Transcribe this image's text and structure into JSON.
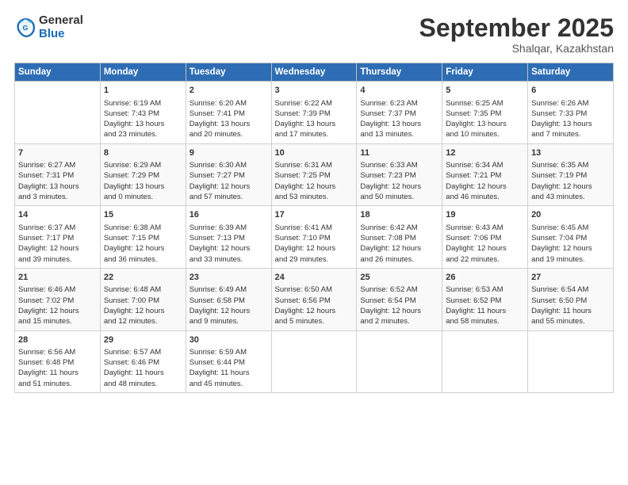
{
  "header": {
    "logo_general": "General",
    "logo_blue": "Blue",
    "month": "September 2025",
    "location": "Shalqar, Kazakhstan"
  },
  "days": [
    "Sunday",
    "Monday",
    "Tuesday",
    "Wednesday",
    "Thursday",
    "Friday",
    "Saturday"
  ],
  "weeks": [
    [
      {
        "date": "",
        "info": ""
      },
      {
        "date": "1",
        "info": "Sunrise: 6:19 AM\nSunset: 7:43 PM\nDaylight: 13 hours\nand 23 minutes."
      },
      {
        "date": "2",
        "info": "Sunrise: 6:20 AM\nSunset: 7:41 PM\nDaylight: 13 hours\nand 20 minutes."
      },
      {
        "date": "3",
        "info": "Sunrise: 6:22 AM\nSunset: 7:39 PM\nDaylight: 13 hours\nand 17 minutes."
      },
      {
        "date": "4",
        "info": "Sunrise: 6:23 AM\nSunset: 7:37 PM\nDaylight: 13 hours\nand 13 minutes."
      },
      {
        "date": "5",
        "info": "Sunrise: 6:25 AM\nSunset: 7:35 PM\nDaylight: 13 hours\nand 10 minutes."
      },
      {
        "date": "6",
        "info": "Sunrise: 6:26 AM\nSunset: 7:33 PM\nDaylight: 13 hours\nand 7 minutes."
      }
    ],
    [
      {
        "date": "7",
        "info": "Sunrise: 6:27 AM\nSunset: 7:31 PM\nDaylight: 13 hours\nand 3 minutes."
      },
      {
        "date": "8",
        "info": "Sunrise: 6:29 AM\nSunset: 7:29 PM\nDaylight: 13 hours\nand 0 minutes."
      },
      {
        "date": "9",
        "info": "Sunrise: 6:30 AM\nSunset: 7:27 PM\nDaylight: 12 hours\nand 57 minutes."
      },
      {
        "date": "10",
        "info": "Sunrise: 6:31 AM\nSunset: 7:25 PM\nDaylight: 12 hours\nand 53 minutes."
      },
      {
        "date": "11",
        "info": "Sunrise: 6:33 AM\nSunset: 7:23 PM\nDaylight: 12 hours\nand 50 minutes."
      },
      {
        "date": "12",
        "info": "Sunrise: 6:34 AM\nSunset: 7:21 PM\nDaylight: 12 hours\nand 46 minutes."
      },
      {
        "date": "13",
        "info": "Sunrise: 6:35 AM\nSunset: 7:19 PM\nDaylight: 12 hours\nand 43 minutes."
      }
    ],
    [
      {
        "date": "14",
        "info": "Sunrise: 6:37 AM\nSunset: 7:17 PM\nDaylight: 12 hours\nand 39 minutes."
      },
      {
        "date": "15",
        "info": "Sunrise: 6:38 AM\nSunset: 7:15 PM\nDaylight: 12 hours\nand 36 minutes."
      },
      {
        "date": "16",
        "info": "Sunrise: 6:39 AM\nSunset: 7:13 PM\nDaylight: 12 hours\nand 33 minutes."
      },
      {
        "date": "17",
        "info": "Sunrise: 6:41 AM\nSunset: 7:10 PM\nDaylight: 12 hours\nand 29 minutes."
      },
      {
        "date": "18",
        "info": "Sunrise: 6:42 AM\nSunset: 7:08 PM\nDaylight: 12 hours\nand 26 minutes."
      },
      {
        "date": "19",
        "info": "Sunrise: 6:43 AM\nSunset: 7:06 PM\nDaylight: 12 hours\nand 22 minutes."
      },
      {
        "date": "20",
        "info": "Sunrise: 6:45 AM\nSunset: 7:04 PM\nDaylight: 12 hours\nand 19 minutes."
      }
    ],
    [
      {
        "date": "21",
        "info": "Sunrise: 6:46 AM\nSunset: 7:02 PM\nDaylight: 12 hours\nand 15 minutes."
      },
      {
        "date": "22",
        "info": "Sunrise: 6:48 AM\nSunset: 7:00 PM\nDaylight: 12 hours\nand 12 minutes."
      },
      {
        "date": "23",
        "info": "Sunrise: 6:49 AM\nSunset: 6:58 PM\nDaylight: 12 hours\nand 9 minutes."
      },
      {
        "date": "24",
        "info": "Sunrise: 6:50 AM\nSunset: 6:56 PM\nDaylight: 12 hours\nand 5 minutes."
      },
      {
        "date": "25",
        "info": "Sunrise: 6:52 AM\nSunset: 6:54 PM\nDaylight: 12 hours\nand 2 minutes."
      },
      {
        "date": "26",
        "info": "Sunrise: 6:53 AM\nSunset: 6:52 PM\nDaylight: 11 hours\nand 58 minutes."
      },
      {
        "date": "27",
        "info": "Sunrise: 6:54 AM\nSunset: 6:50 PM\nDaylight: 11 hours\nand 55 minutes."
      }
    ],
    [
      {
        "date": "28",
        "info": "Sunrise: 6:56 AM\nSunset: 6:48 PM\nDaylight: 11 hours\nand 51 minutes."
      },
      {
        "date": "29",
        "info": "Sunrise: 6:57 AM\nSunset: 6:46 PM\nDaylight: 11 hours\nand 48 minutes."
      },
      {
        "date": "30",
        "info": "Sunrise: 6:59 AM\nSunset: 6:44 PM\nDaylight: 11 hours\nand 45 minutes."
      },
      {
        "date": "",
        "info": ""
      },
      {
        "date": "",
        "info": ""
      },
      {
        "date": "",
        "info": ""
      },
      {
        "date": "",
        "info": ""
      }
    ]
  ]
}
